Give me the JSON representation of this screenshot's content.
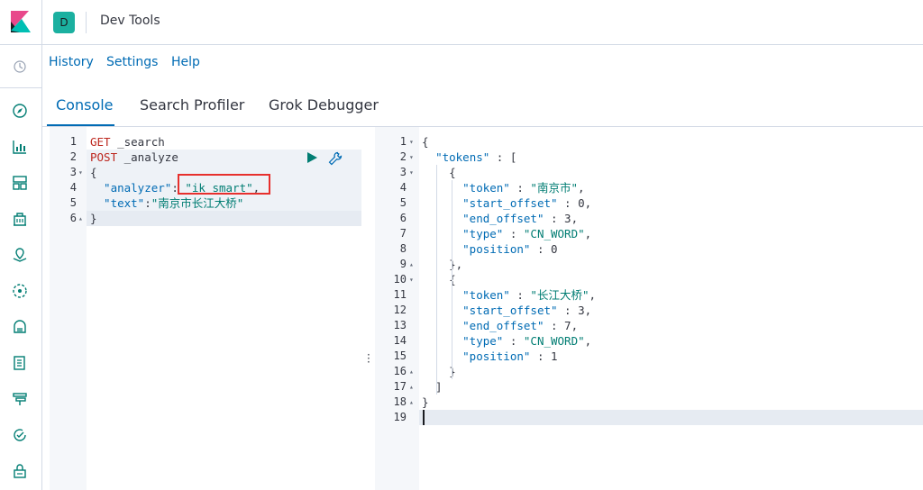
{
  "header": {
    "space_initial": "D",
    "app_title": "Dev Tools"
  },
  "menu": {
    "history": "History",
    "settings": "Settings",
    "help": "Help"
  },
  "tabs": [
    {
      "label": "Console",
      "active": true
    },
    {
      "label": "Search Profiler",
      "active": false
    },
    {
      "label": "Grok Debugger",
      "active": false
    }
  ],
  "sidenav": {
    "icons": [
      "recent-icon",
      "discover-icon",
      "visualize-icon",
      "dashboard-icon",
      "canvas-icon",
      "maps-icon",
      "ml-icon",
      "infrastructure-icon",
      "logs-icon",
      "apm-icon",
      "uptime-icon",
      "security-icon"
    ]
  },
  "request_editor": {
    "line_numbers": [
      "1",
      "2",
      "3",
      "4",
      "5",
      "6"
    ],
    "lines": {
      "l1_method": "GET",
      "l1_path": " _search",
      "l2_method": "POST",
      "l2_path": " _analyze",
      "l3": "{",
      "l4_key": "  \"analyzer\"",
      "l4_colon": ": ",
      "l4_value": "\"ik_smart\"",
      "l4_comma": ",",
      "l5_key": "  \"text\"",
      "l5_colon": ":",
      "l5_value": "\"南京市长江大桥\"",
      "l6": "}"
    }
  },
  "response_editor": {
    "line_numbers": [
      "1",
      "2",
      "3",
      "4",
      "5",
      "6",
      "7",
      "8",
      "9",
      "10",
      "11",
      "12",
      "13",
      "14",
      "15",
      "16",
      "17",
      "18",
      "19"
    ],
    "lines": [
      "{",
      "  \"tokens\" : [",
      "    {",
      "      \"token\" : \"南京市\",",
      "      \"start_offset\" : 0,",
      "      \"end_offset\" : 3,",
      "      \"type\" : \"CN_WORD\",",
      "      \"position\" : 0",
      "    },",
      "    {",
      "      \"token\" : \"长江大桥\",",
      "      \"start_offset\" : 3,",
      "      \"end_offset\" : 7,",
      "      \"type\" : \"CN_WORD\",",
      "      \"position\" : 1",
      "    }",
      "  ]",
      "}",
      ""
    ]
  },
  "colors": {
    "accent": "#006bb4",
    "brand_teal": "#1bb0a0",
    "highlight_box": "#e7302d",
    "play_button": "#017d73"
  }
}
